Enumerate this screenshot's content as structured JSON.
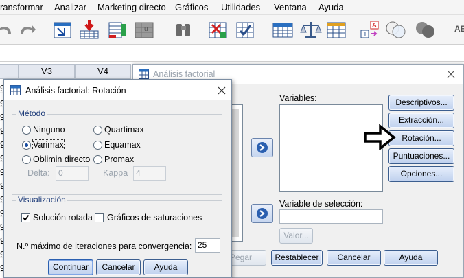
{
  "menubar": {
    "items": [
      "ransformar",
      "Analizar",
      "Marketing directo",
      "Gráficos",
      "Utilidades",
      "Ventana",
      "Ayuda"
    ]
  },
  "toolbar": {
    "icons": [
      "undo-icon",
      "redo-icon",
      "goto-case-icon",
      "goto-variable-icon",
      "variables-icon",
      "run-descriptive-icon",
      "find-icon",
      "insert-cases-icon",
      "insert-variable-icon",
      "split-file-icon",
      "weight-cases-icon",
      "select-cases-icon",
      "value-labels-icon",
      "use-sets-icon",
      "show-all-variables-icon",
      "spell-check-icon"
    ],
    "partial_text": "AE"
  },
  "grid": {
    "col_headers": [
      "V3",
      "V4"
    ],
    "row_numbers_left": [
      "9",
      "9",
      "9",
      "9",
      "9",
      "9",
      "9",
      "9",
      "9",
      "9",
      "9",
      "9",
      "9",
      "9"
    ]
  },
  "factor_dialog": {
    "title": "Análisis factorial",
    "variables_label": "Variables:",
    "selection_label": "Variable de selección:",
    "value_button": "Valor...",
    "side_buttons": [
      "Descriptivos...",
      "Extracción...",
      "Rotación...",
      "Puntuaciones...",
      "Opciones..."
    ],
    "bottom_buttons": [
      "Pegar",
      "Restablecer",
      "Cancelar",
      "Ayuda"
    ]
  },
  "rotation_dialog": {
    "title": "Análisis factorial: Rotación",
    "method_group": "Método",
    "methods": [
      {
        "label": "Ninguno",
        "checked": false
      },
      {
        "label": "Quartimax",
        "checked": false
      },
      {
        "label": "Varimax",
        "checked": true
      },
      {
        "label": "Equamax",
        "checked": false
      },
      {
        "label": "Oblimin directo",
        "checked": false
      },
      {
        "label": "Promax",
        "checked": false
      }
    ],
    "delta_label": "Delta:",
    "delta_value": "0",
    "kappa_label": "Kappa",
    "kappa_value": "4",
    "display_group": "Visualización",
    "rotated_solution_label": "Solución rotada",
    "rotated_solution_checked": true,
    "loading_plots_label": "Gráficos de saturaciones",
    "loading_plots_checked": false,
    "max_iter_label": "N.º máximo de iteraciones para convergencia:",
    "max_iter_value": "25",
    "buttons": [
      "Continuar",
      "Cancelar",
      "Ayuda"
    ]
  },
  "colors": {
    "accent": "#1a4da0",
    "button_border": "#3c5e8f",
    "group_title": "#1f3d7a"
  }
}
